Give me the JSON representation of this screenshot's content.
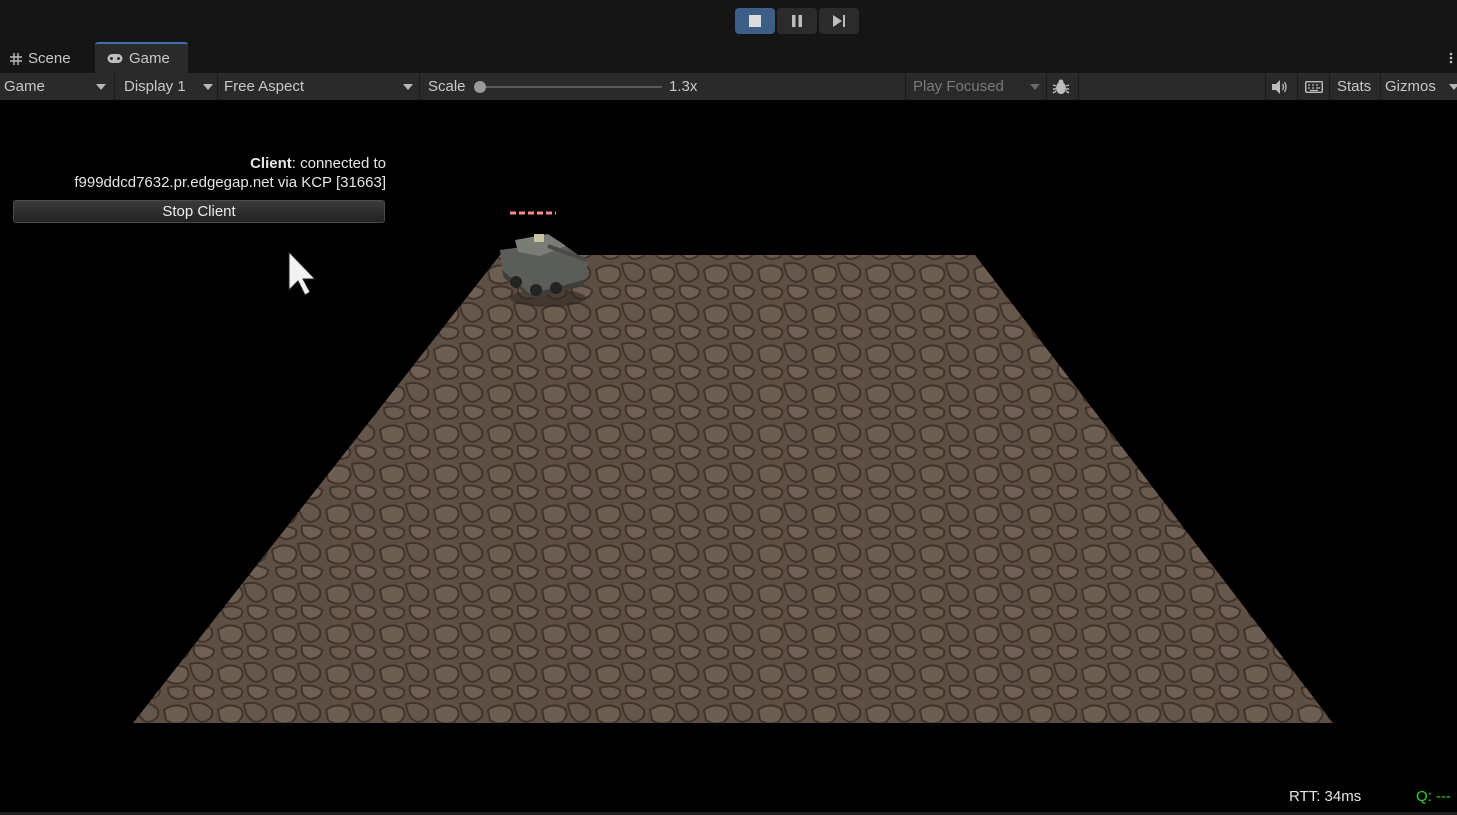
{
  "window": {
    "playbar": {
      "buttons": [
        {
          "name": "stop",
          "icon": "stop-square-icon",
          "active": true
        },
        {
          "name": "pause",
          "icon": "pause-icon",
          "active": false
        },
        {
          "name": "step",
          "icon": "step-forward-icon",
          "active": false
        }
      ]
    },
    "tabs": [
      {
        "label": "Scene",
        "icon": "grid-hash-icon",
        "selected": false
      },
      {
        "label": "Game",
        "icon": "gamepad-icon",
        "selected": true
      }
    ]
  },
  "toolbar": {
    "view_mode": "Game",
    "display": "Display 1",
    "aspect": "Free Aspect",
    "scale_label": "Scale",
    "scale_value": "1.3x",
    "scale_fraction": 0.0,
    "play_mode": "Play Focused",
    "stats_label": "Stats",
    "gizmos_label": "Gizmos",
    "icons": [
      "bug-icon",
      "speaker-icon",
      "keyboard-icon"
    ]
  },
  "game_view": {
    "client_label": "Client",
    "client_status": ": connected to",
    "server_line": "f999ddcd7632.pr.edgegap.net via KCP [31663]",
    "stop_client_label": "Stop Client",
    "rtt_text": "RTT: 34ms",
    "quality_text": "Q: ---",
    "colors": {
      "ground": "#6b5a4e",
      "health_bar": "#ff8a8a",
      "quality": "#2fd22f"
    }
  }
}
